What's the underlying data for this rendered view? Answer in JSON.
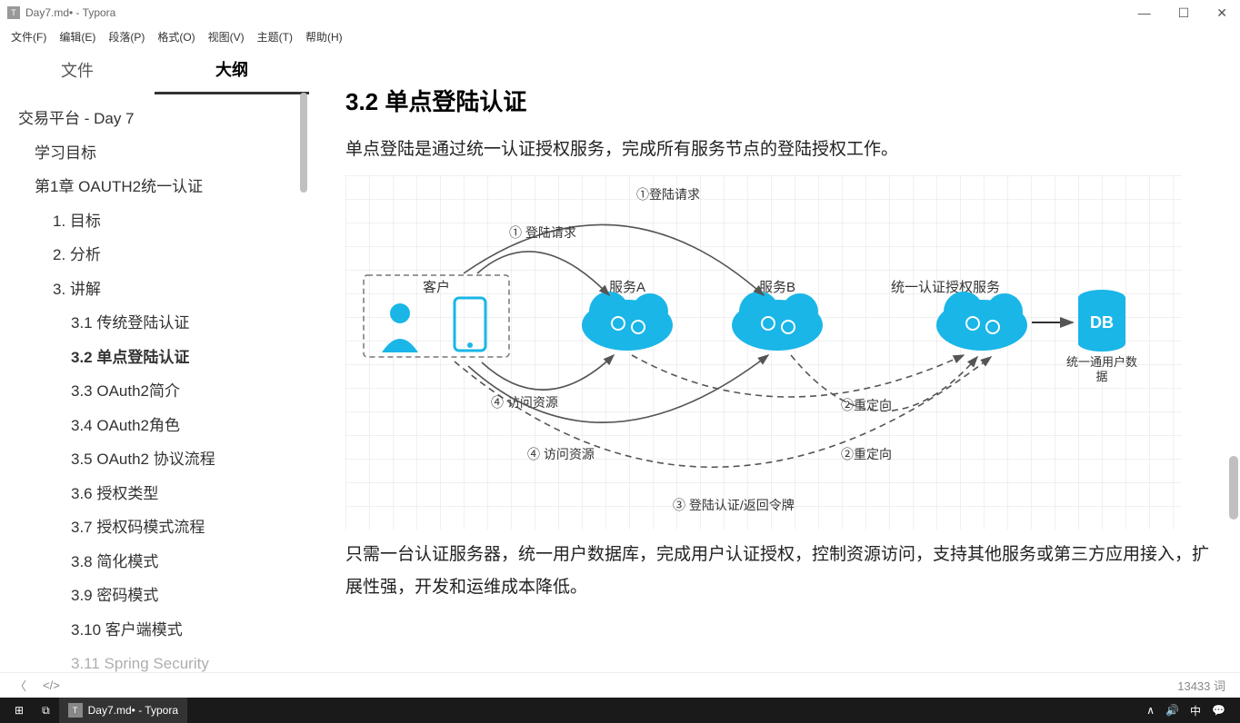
{
  "window": {
    "title": "Day7.md• - Typora",
    "icon_label": "T",
    "controls": {
      "min": "—",
      "max": "☐",
      "close": "✕"
    }
  },
  "menubar": [
    "文件(F)",
    "编辑(E)",
    "段落(P)",
    "格式(O)",
    "视图(V)",
    "主题(T)",
    "帮助(H)"
  ],
  "sidebar": {
    "tabs": {
      "files": "文件",
      "outline": "大纲"
    },
    "active_tab": "outline",
    "outline": [
      {
        "level": 0,
        "label": "交易平台 - Day 7"
      },
      {
        "level": 1,
        "label": "学习目标"
      },
      {
        "level": 1,
        "label": "第1章 OAUTH2统一认证"
      },
      {
        "level": 2,
        "label": "1. 目标"
      },
      {
        "level": 2,
        "label": "2. 分析"
      },
      {
        "level": 2,
        "label": "3. 讲解"
      },
      {
        "level": 3,
        "label": "3.1 传统登陆认证"
      },
      {
        "level": 3,
        "label": "3.2 单点登陆认证",
        "active": true
      },
      {
        "level": 3,
        "label": "3.3 OAuth2简介"
      },
      {
        "level": 3,
        "label": "3.4 OAuth2角色"
      },
      {
        "level": 3,
        "label": "3.5 OAuth2 协议流程"
      },
      {
        "level": 3,
        "label": "3.6 授权类型"
      },
      {
        "level": 3,
        "label": "3.7 授权码模式流程"
      },
      {
        "level": 3,
        "label": "3.8 简化模式"
      },
      {
        "level": 3,
        "label": "3.9 密码模式"
      },
      {
        "level": 3,
        "label": "3.10 客户端模式"
      },
      {
        "level": 3,
        "label": "3.11 Spring Security"
      }
    ]
  },
  "content": {
    "heading": "3.2 单点登陆认证",
    "para1": "单点登陆是通过统一认证授权服务，完成所有服务节点的登陆授权工作。",
    "para2": "只需一台认证服务器，统一用户数据库，完成用户认证授权，控制资源访问，支持其他服务或第三方应用接入，扩展性强，开发和运维成本降低。",
    "diagram": {
      "client": "客户",
      "serviceA": "服务A",
      "serviceB": "服务B",
      "auth": "统一认证授权服务",
      "db": "DB",
      "db_label": "统一通用户数据",
      "edges": {
        "e1": "①登陆请求",
        "e1b": "① 登陆请求",
        "e2_1": "②重定向",
        "e2_2": "②重定向",
        "e3": "③ 登陆认证/返回令牌",
        "e4_1": "④ 访问资源",
        "e4_2": "④ 访问资源"
      }
    }
  },
  "statusbar": {
    "back": "〈",
    "source": "</>",
    "words": "13433 词"
  },
  "taskbar": {
    "start": "⊞",
    "tasks": "⧉",
    "app_icon": "T",
    "app_label": "Day7.md• - Typora",
    "tray": {
      "up": "∧",
      "vol": "🔊",
      "ime": "中",
      "notif": "💬"
    }
  }
}
